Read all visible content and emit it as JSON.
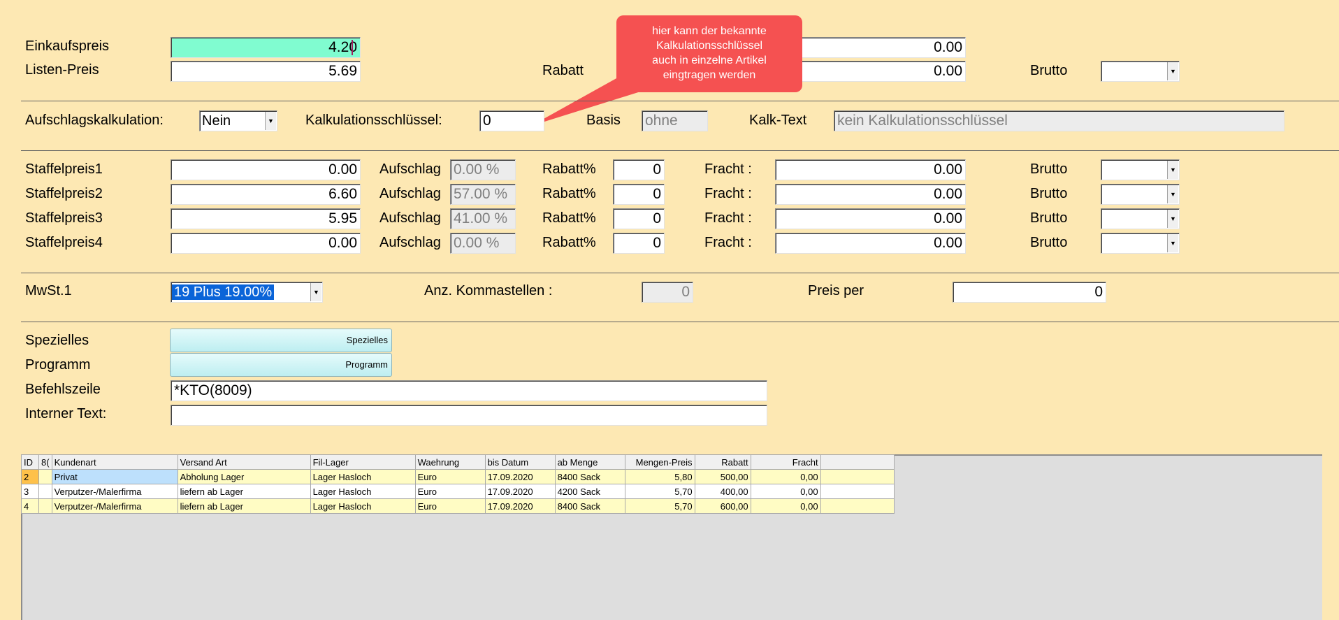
{
  "top": {
    "einkaufspreis_label": "Einkaufspreis",
    "einkaufspreis_value": "4.20",
    "listenpreis_label": "Listen-Preis",
    "listenpreis_value": "5.69",
    "rabatt_label": "Rabatt",
    "field1_value": "0.00",
    "field2_value": "0.00",
    "brutto_label": "Brutto"
  },
  "callout": {
    "lines": [
      "hier kann der bekannte",
      "Kalkulationsschlüssel",
      "auch in einzelne Artikel",
      "eingtragen werden"
    ]
  },
  "kalk": {
    "aufschlag_label": "Aufschlagskalkulation:",
    "aufschlag_value": "Nein",
    "schluessel_label": "Kalkulationsschlüssel:",
    "schluessel_value": "0",
    "basis_label": "Basis",
    "basis_value": "ohne",
    "kalktext_label": "Kalk-Text",
    "kalktext_value": "kein Kalkulationsschlüssel"
  },
  "staffel": {
    "aufschlag_label": "Aufschlag",
    "rabatt_label": "Rabatt%",
    "fracht_label": "Fracht :",
    "brutto_label": "Brutto",
    "rows": [
      {
        "label": "Staffelpreis1",
        "price": "0.00",
        "aufschlag": "0.00 %",
        "rabatt": "0",
        "fracht": "0.00"
      },
      {
        "label": "Staffelpreis2",
        "price": "6.60",
        "aufschlag": "57.00 %",
        "rabatt": "0",
        "fracht": "0.00"
      },
      {
        "label": "Staffelpreis3",
        "price": "5.95",
        "aufschlag": "41.00 %",
        "rabatt": "0",
        "fracht": "0.00"
      },
      {
        "label": "Staffelpreis4",
        "price": "0.00",
        "aufschlag": "0.00 %",
        "rabatt": "0",
        "fracht": "0.00"
      }
    ]
  },
  "mwst": {
    "label": "MwSt.1",
    "value": "19 Plus 19.00%",
    "komma_label": "Anz. Kommastellen :",
    "komma_value": "0",
    "preisper_label": "Preis per",
    "preisper_value": "0"
  },
  "misc": {
    "spezielles_label": "Spezielles",
    "spezielles_button": "Spezielles",
    "programm_label": "Programm",
    "programm_button": "Programm",
    "befehl_label": "Befehlszeile",
    "befehl_value": "*KTO(8009)",
    "interner_label": "Interner Text:",
    "interner_value": ""
  },
  "grid": {
    "columns": [
      "ID",
      "8(",
      "Kundenart",
      "Versand Art",
      "Fil-Lager",
      "Waehrung",
      "bis Datum",
      "ab Menge",
      "Mengen-Preis",
      "Rabatt",
      "Fracht",
      ""
    ],
    "rows": [
      [
        "2",
        "",
        "Privat",
        "Abholung Lager",
        "Lager Hasloch",
        "Euro",
        "17.09.2020",
        "8400  Sack",
        "5,80",
        "500,00",
        "0,00",
        ""
      ],
      [
        "3",
        "",
        "Verputzer-/Malerfirma",
        "liefern ab Lager",
        "Lager Hasloch",
        "Euro",
        "17.09.2020",
        "4200  Sack",
        "5,70",
        "400,00",
        "0,00",
        ""
      ],
      [
        "4",
        "",
        "Verputzer-/Malerfirma",
        "liefern ab Lager",
        "Lager Hasloch",
        "Euro",
        "17.09.2020",
        "8400  Sack",
        "5,70",
        "600,00",
        "0,00",
        ""
      ]
    ]
  }
}
